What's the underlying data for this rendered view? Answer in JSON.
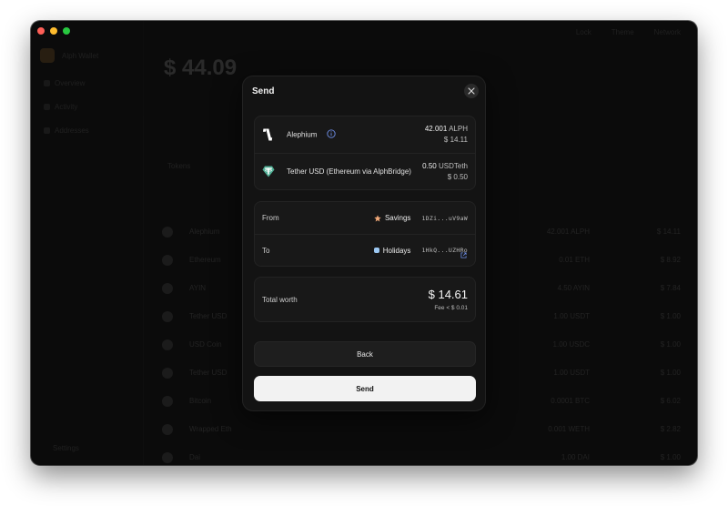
{
  "window": {
    "traffic_lights": [
      "close",
      "minimize",
      "zoom"
    ]
  },
  "background": {
    "wallet_name": "Alph Wallet",
    "nav_items": [
      "Overview",
      "Activity",
      "Addresses"
    ],
    "settings_label": "Settings",
    "total_amount": "$ 44.09",
    "tab_label": "Tokens",
    "top_items": [
      "Lock",
      "Theme",
      "Network"
    ],
    "rows": [
      {
        "name": "Alephium",
        "v1": "42.001 ALPH",
        "v2": "$ 14.11"
      },
      {
        "name": "Ethereum",
        "v1": "0.01 ETH",
        "v2": "$ 8.92"
      },
      {
        "name": "AYIN",
        "v1": "4.50 AYIN",
        "v2": "$ 7.84"
      },
      {
        "name": "Tether USD",
        "v1": "1.00 USDT",
        "v2": "$ 1.00"
      },
      {
        "name": "USD Coin",
        "v1": "1.00 USDC",
        "v2": "$ 1.00"
      },
      {
        "name": "Tether USD",
        "v1": "1.00 USDT",
        "v2": "$ 1.00"
      },
      {
        "name": "Bitcoin",
        "v1": "0.0001 BTC",
        "v2": "$ 6.02"
      },
      {
        "name": "Wrapped Eth",
        "v1": "0.001 WETH",
        "v2": "$ 2.82"
      },
      {
        "name": "Dai",
        "v1": "1.00 DAI",
        "v2": "$ 1.00"
      }
    ]
  },
  "modal": {
    "title": "Send",
    "assets": [
      {
        "name": "Alephium",
        "amount": "42.001",
        "unit": "ALPH",
        "fiat": "$ 14.11",
        "icon": "alephium-logo",
        "has_info": true
      },
      {
        "name": "Tether USD (Ethereum via AlphBridge)",
        "amount": "0.50",
        "unit": "USDTeth",
        "fiat": "$ 0.50",
        "icon": "tether-logo",
        "has_info": false
      }
    ],
    "from": {
      "label": "From",
      "name": "Savings",
      "hash": "1DZi...uV9aW",
      "icon": "star-icon"
    },
    "to": {
      "label": "To",
      "name": "Holidays",
      "hash": "1HkQ...UZHRo",
      "icon": "square-dot-icon"
    },
    "total": {
      "label": "Total worth",
      "amount": "$ 14.61",
      "fee": "Fee < $ 0.01"
    },
    "back_label": "Back",
    "send_label": "Send"
  }
}
